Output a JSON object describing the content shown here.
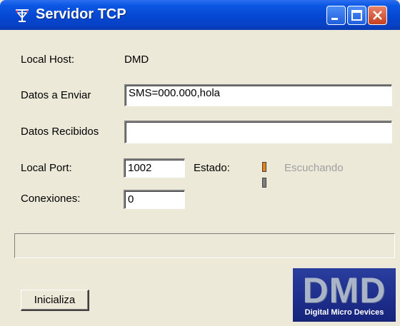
{
  "window": {
    "title": "Servidor TCP"
  },
  "form": {
    "local_host_label": "Local Host:",
    "local_host_value": "DMD",
    "datos_enviar_label": "Datos a Enviar",
    "datos_enviar_value": "SMS=000.000,hola",
    "datos_recibidos_label": "Datos Recibidos",
    "datos_recibidos_value": "",
    "local_port_label": "Local Port:",
    "local_port_value": "1002",
    "estado_label": "Estado:",
    "estado_value": "Escuchando",
    "conexiones_label": "Conexiones:",
    "conexiones_value": "0"
  },
  "leds": {
    "listening_color": "#e8801a",
    "idle_color": "#808080"
  },
  "buttons": {
    "inicializa_label": "Inicializa"
  },
  "logo": {
    "big_text": "DMD",
    "small_text": "Digital Micro Devices"
  },
  "icons": {
    "title_icon": "antenna-icon",
    "minimize": "minimize-icon",
    "maximize": "maximize-icon",
    "close": "close-icon"
  }
}
